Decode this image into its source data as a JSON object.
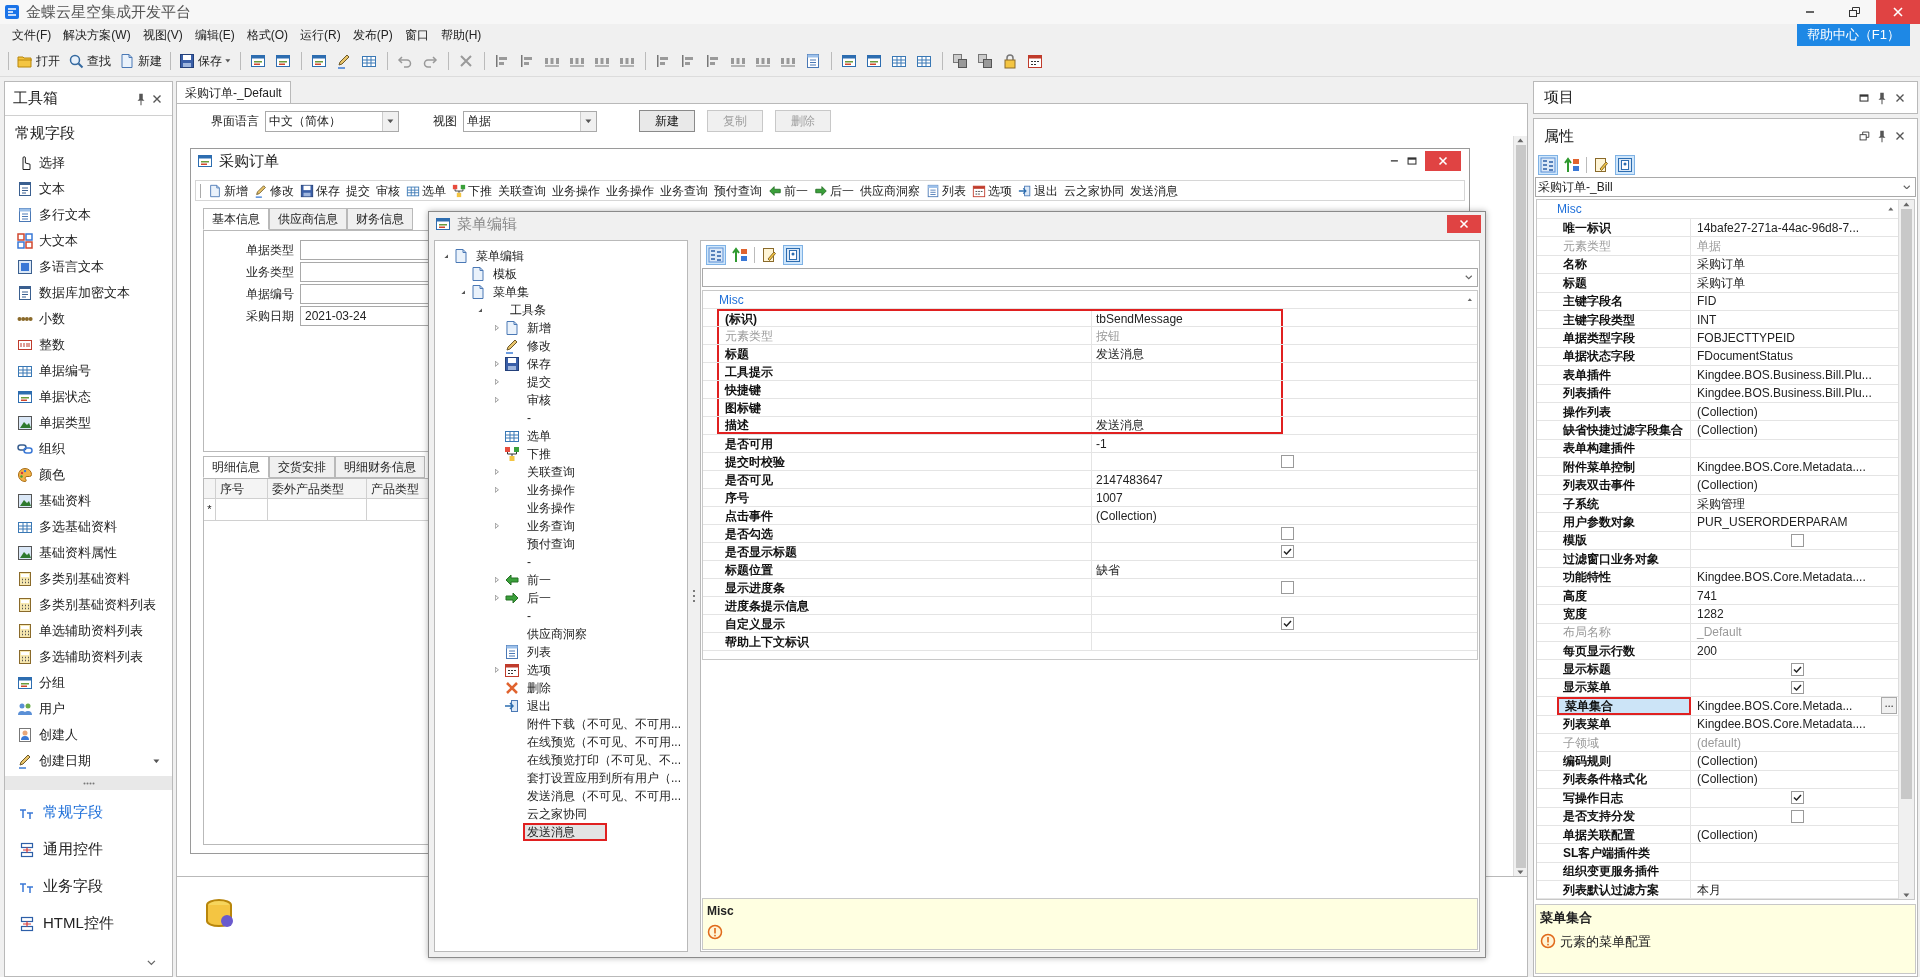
{
  "app": {
    "title": "金蝶云星空集成开发平台",
    "help_button": "帮助中心（F1）"
  },
  "menu": [
    "文件(F)",
    "解决方案(W)",
    "视图(V)",
    "编辑(E)",
    "格式(O)",
    "运行(R)",
    "发布(P)",
    "窗口",
    "帮助(H)"
  ],
  "toolbar": [
    {
      "label": "打开",
      "dropdown": false
    },
    {
      "label": "查找",
      "dropdown": false
    },
    {
      "label": "新建",
      "dropdown": false
    },
    {
      "label": "保存",
      "dropdown": true
    }
  ],
  "toolbox": {
    "title": "工具箱",
    "section": "常规字段",
    "items": [
      "选择",
      "文本",
      "多行文本",
      "大文本",
      "多语言文本",
      "数据库加密文本",
      "小数",
      "整数",
      "单据编号",
      "单据状态",
      "单据类型",
      "组织",
      "颜色",
      "基础资料",
      "多选基础资料",
      "基础资料属性",
      "多类别基础资料",
      "多类别基础资料列表",
      "单选辅助资料列表",
      "多选辅助资料列表",
      "分组",
      "用户",
      "创建人",
      "创建日期"
    ],
    "categories": [
      {
        "label": "常规字段",
        "selected": true
      },
      {
        "label": "通用控件",
        "selected": false
      },
      {
        "label": "业务字段",
        "selected": false
      },
      {
        "label": "HTML控件",
        "selected": false
      }
    ]
  },
  "document": {
    "tab": {
      "label": "采购订单-_Default",
      "selected": true
    },
    "language": {
      "label": "界面语言",
      "value": "中文（简体）"
    },
    "view": {
      "label": "视图",
      "value": "单据"
    },
    "buttons": [
      {
        "label": "新建",
        "disabled": false
      },
      {
        "label": "复制",
        "disabled": true
      },
      {
        "label": "删除",
        "disabled": true
      }
    ]
  },
  "form": {
    "title": "采购订单",
    "toolbar": [
      "新增",
      "修改",
      "保存",
      "提交",
      "审核",
      "选单",
      "下推",
      "关联查询",
      "业务操作",
      "业务操作",
      "业务查询",
      "预付查询",
      "前一",
      "后一",
      "供应商洞察",
      "列表",
      "选项",
      "退出",
      "云之家协同",
      "发送消息"
    ],
    "tabs": [
      {
        "label": "基本信息",
        "selected": true
      },
      {
        "label": "供应商信息",
        "selected": false
      },
      {
        "label": "财务信息",
        "selected": false
      }
    ],
    "fields": [
      {
        "label": "单据类型"
      },
      {
        "label": "业务类型"
      },
      {
        "label": "单据编号"
      },
      {
        "label": "采购日期",
        "value": "2021-03-24"
      }
    ],
    "detail_tabs": [
      {
        "label": "明细信息",
        "selected": true
      },
      {
        "label": "交货安排",
        "selected": false
      },
      {
        "label": "明细财务信息",
        "selected": false
      }
    ],
    "grid": {
      "columns": [
        "序号",
        "委外产品类型",
        "产品类型"
      ],
      "new_row_marker": "*"
    }
  },
  "menu_editor": {
    "title": "菜单编辑",
    "tree": [
      {
        "label": "菜单编辑",
        "expanded": true,
        "selected": false,
        "highlighted": false,
        "children": [
          {
            "label": "模板",
            "selected": false,
            "highlighted": false
          },
          {
            "label": "菜单集",
            "expanded": true,
            "selected": false,
            "highlighted": false,
            "children": [
              {
                "label": "工具条",
                "expanded": true,
                "selected": false,
                "highlighted": false,
                "children": [
                  {
                    "label": "新增",
                    "expanded": false,
                    "selected": false,
                    "highlighted": false
                  },
                  {
                    "label": "修改",
                    "selected": false,
                    "highlighted": false
                  },
                  {
                    "label": "保存",
                    "expanded": false,
                    "selected": false,
                    "highlighted": false
                  },
                  {
                    "label": "提交",
                    "expanded": false,
                    "selected": false,
                    "highlighted": false
                  },
                  {
                    "label": "审核",
                    "expanded": false,
                    "selected": false,
                    "highlighted": false
                  },
                  {
                    "label": "-",
                    "selected": false,
                    "highlighted": false
                  },
                  {
                    "label": "选单",
                    "selected": false,
                    "highlighted": false
                  },
                  {
                    "label": "下推",
                    "selected": false,
                    "highlighted": false
                  },
                  {
                    "label": "关联查询",
                    "expanded": false,
                    "selected": false,
                    "highlighted": false
                  },
                  {
                    "label": "业务操作",
                    "expanded": false,
                    "selected": false,
                    "highlighted": false
                  },
                  {
                    "label": "业务操作",
                    "selected": false,
                    "highlighted": false
                  },
                  {
                    "label": "业务查询",
                    "expanded": false,
                    "selected": false,
                    "highlighted": false
                  },
                  {
                    "label": "预付查询",
                    "selected": false,
                    "highlighted": false
                  },
                  {
                    "label": "-",
                    "selected": false,
                    "highlighted": false
                  },
                  {
                    "label": "前一",
                    "expanded": false,
                    "selected": false,
                    "highlighted": false
                  },
                  {
                    "label": "后一",
                    "expanded": false,
                    "selected": false,
                    "highlighted": false
                  },
                  {
                    "label": "-",
                    "selected": false,
                    "highlighted": false
                  },
                  {
                    "label": "供应商洞察",
                    "selected": false,
                    "highlighted": false
                  },
                  {
                    "label": "列表",
                    "selected": false,
                    "highlighted": false
                  },
                  {
                    "label": "选项",
                    "expanded": false,
                    "selected": false,
                    "highlighted": false
                  },
                  {
                    "label": "删除",
                    "selected": false,
                    "highlighted": false
                  },
                  {
                    "label": "退出",
                    "selected": false,
                    "highlighted": false
                  },
                  {
                    "label": "附件下载（不可见、不可用...",
                    "selected": false,
                    "highlighted": false
                  },
                  {
                    "label": "在线预览（不可见、不可用...",
                    "selected": false,
                    "highlighted": false
                  },
                  {
                    "label": "在线预览打印（不可见、不...",
                    "selected": false,
                    "highlighted": false
                  },
                  {
                    "label": "套打设置应用到所有用户（...",
                    "selected": false,
                    "highlighted": false
                  },
                  {
                    "label": "发送消息（不可见、不可用...",
                    "selected": false,
                    "highlighted": false
                  },
                  {
                    "label": "云之家协同",
                    "selected": false,
                    "highlighted": false
                  },
                  {
                    "label": "发送消息",
                    "selected": true,
                    "highlighted": true
                  }
                ]
              }
            ]
          }
        ]
      }
    ],
    "properties": {
      "category": "Misc",
      "rows": [
        {
          "name": "(标识)",
          "kind": "text",
          "value": "tbSendMessage",
          "disabled": false,
          "highlighted": true
        },
        {
          "name": "元素类型",
          "kind": "text",
          "value": "按钮",
          "disabled": true,
          "highlighted": true
        },
        {
          "name": "标题",
          "kind": "text",
          "value": "发送消息",
          "disabled": false,
          "highlighted": true
        },
        {
          "name": "工具提示",
          "kind": "text",
          "disabled": false,
          "highlighted": true
        },
        {
          "name": "快捷键",
          "kind": "text",
          "disabled": false,
          "highlighted": true
        },
        {
          "name": "图标键",
          "kind": "text",
          "disabled": false,
          "highlighted": true
        },
        {
          "name": "描述",
          "kind": "text",
          "value": "发送消息",
          "disabled": false,
          "highlighted": true
        },
        {
          "name": "是否可用",
          "kind": "text",
          "value": "-1",
          "disabled": false,
          "highlighted": false
        },
        {
          "name": "提交时校验",
          "kind": "checkbox",
          "checked": false,
          "disabled": false,
          "highlighted": false
        },
        {
          "name": "是否可见",
          "kind": "text",
          "value": "2147483647",
          "disabled": false,
          "highlighted": false
        },
        {
          "name": "序号",
          "kind": "text",
          "value": "1007",
          "disabled": false,
          "highlighted": false
        },
        {
          "name": "点击事件",
          "kind": "text",
          "value": "(Collection)",
          "disabled": false,
          "highlighted": false
        },
        {
          "name": "是否勾选",
          "kind": "checkbox",
          "checked": false,
          "disabled": false,
          "highlighted": false
        },
        {
          "name": "是否显示标题",
          "kind": "checkbox",
          "checked": true,
          "disabled": false,
          "highlighted": false
        },
        {
          "name": "标题位置",
          "kind": "text",
          "value": "缺省",
          "disabled": false,
          "highlighted": false
        },
        {
          "name": "显示进度条",
          "kind": "checkbox",
          "checked": false,
          "disabled": false,
          "highlighted": false
        },
        {
          "name": "进度条提示信息",
          "kind": "text",
          "disabled": false,
          "highlighted": false
        },
        {
          "name": "自定义显示",
          "kind": "checkbox",
          "checked": true,
          "disabled": false,
          "highlighted": false
        },
        {
          "name": "帮助上下文标识",
          "kind": "text",
          "disabled": false,
          "highlighted": false
        }
      ]
    },
    "description": {
      "title": "Misc"
    }
  },
  "project_panel": {
    "title": "项目"
  },
  "properties_panel": {
    "title": "属性",
    "object": "采购订单-_Bill",
    "category": "Misc",
    "rows": [
      {
        "name": "唯一标识",
        "kind": "text",
        "value": "14bafe27-271a-44ac-96d8-7...",
        "disabled": false,
        "selected": false,
        "highlighted": false
      },
      {
        "name": "元素类型",
        "kind": "text",
        "value": "单据",
        "disabled": true,
        "selected": false,
        "highlighted": false
      },
      {
        "name": "名称",
        "kind": "text",
        "value": "采购订单",
        "disabled": false,
        "selected": false,
        "highlighted": false
      },
      {
        "name": "标题",
        "kind": "text",
        "value": "采购订单",
        "disabled": false,
        "selected": false,
        "highlighted": false
      },
      {
        "name": "主键字段名",
        "kind": "text",
        "value": "FID",
        "disabled": false,
        "selected": false,
        "highlighted": false
      },
      {
        "name": "主键字段类型",
        "kind": "text",
        "value": "INT",
        "disabled": false,
        "selected": false,
        "highlighted": false
      },
      {
        "name": "单据类型字段",
        "kind": "text",
        "value": "FOBJECTTYPEID",
        "disabled": false,
        "selected": false,
        "highlighted": false
      },
      {
        "name": "单据状态字段",
        "kind": "text",
        "value": "FDocumentStatus",
        "disabled": false,
        "selected": false,
        "highlighted": false
      },
      {
        "name": "表单插件",
        "kind": "text",
        "value": "Kingdee.BOS.Business.Bill.Plu...",
        "disabled": false,
        "selected": false,
        "highlighted": false
      },
      {
        "name": "列表插件",
        "kind": "text",
        "value": "Kingdee.BOS.Business.Bill.Plu...",
        "disabled": false,
        "selected": false,
        "highlighted": false
      },
      {
        "name": "操作列表",
        "kind": "text",
        "value": "(Collection)",
        "disabled": false,
        "selected": false,
        "highlighted": false
      },
      {
        "name": "缺省快捷过滤字段集合",
        "kind": "text",
        "value": "(Collection)",
        "disabled": false,
        "selected": false,
        "highlighted": false
      },
      {
        "name": "表单构建插件",
        "kind": "text",
        "disabled": false,
        "selected": false,
        "highlighted": false
      },
      {
        "name": "附件菜单控制",
        "kind": "text",
        "value": "Kingdee.BOS.Core.Metadata....",
        "disabled": false,
        "selected": false,
        "highlighted": false
      },
      {
        "name": "列表双击事件",
        "kind": "text",
        "value": "(Collection)",
        "disabled": false,
        "selected": false,
        "highlighted": false
      },
      {
        "name": "子系统",
        "kind": "text",
        "value": "采购管理",
        "disabled": false,
        "selected": false,
        "highlighted": false
      },
      {
        "name": "用户参数对象",
        "kind": "text",
        "value": "PUR_USERORDERPARAM",
        "disabled": false,
        "selected": false,
        "highlighted": false
      },
      {
        "name": "模版",
        "kind": "checkbox",
        "checked": false,
        "disabled": false,
        "selected": false,
        "highlighted": false
      },
      {
        "name": "过滤窗口业务对象",
        "kind": "text",
        "disabled": false,
        "selected": false,
        "highlighted": false
      },
      {
        "name": "功能特性",
        "kind": "text",
        "value": "Kingdee.BOS.Core.Metadata....",
        "disabled": false,
        "selected": false,
        "highlighted": false
      },
      {
        "name": "高度",
        "kind": "text",
        "value": "741",
        "disabled": false,
        "selected": false,
        "highlighted": false
      },
      {
        "name": "宽度",
        "kind": "text",
        "value": "1282",
        "disabled": false,
        "selected": false,
        "highlighted": false
      },
      {
        "name": "布局名称",
        "kind": "text",
        "value": "_Default",
        "disabled": true,
        "selected": false,
        "highlighted": false
      },
      {
        "name": "每页显示行数",
        "kind": "text",
        "value": "200",
        "disabled": false,
        "selected": false,
        "highlighted": false
      },
      {
        "name": "显示标题",
        "kind": "checkbox",
        "checked": true,
        "disabled": false,
        "selected": false,
        "highlighted": false
      },
      {
        "name": "显示菜单",
        "kind": "checkbox",
        "checked": true,
        "disabled": false,
        "selected": false,
        "highlighted": false
      },
      {
        "name": "菜单集合",
        "kind": "text",
        "value": "Kingdee.BOS.Core.Metada...",
        "disabled": false,
        "selected": true,
        "highlighted": true
      },
      {
        "name": "列表菜单",
        "kind": "text",
        "value": "Kingdee.BOS.Core.Metadata....",
        "disabled": false,
        "selected": false,
        "highlighted": false
      },
      {
        "name": "子领域",
        "kind": "text",
        "value": "(default)",
        "disabled": true,
        "selected": false,
        "highlighted": false
      },
      {
        "name": "编码规则",
        "kind": "text",
        "value": "(Collection)",
        "disabled": false,
        "selected": false,
        "highlighted": false
      },
      {
        "name": "列表条件格式化",
        "kind": "text",
        "value": "(Collection)",
        "disabled": false,
        "selected": false,
        "highlighted": false
      },
      {
        "name": "写操作日志",
        "kind": "checkbox",
        "checked": true,
        "disabled": false,
        "selected": false,
        "highlighted": false
      },
      {
        "name": "是否支持分发",
        "kind": "checkbox",
        "checked": false,
        "disabled": false,
        "selected": false,
        "highlighted": false
      },
      {
        "name": "单据关联配置",
        "kind": "text",
        "value": "(Collection)",
        "disabled": false,
        "selected": false,
        "highlighted": false
      },
      {
        "name": "SL客户端插件类",
        "kind": "text",
        "disabled": false,
        "selected": false,
        "highlighted": false
      },
      {
        "name": "组织变更服务插件",
        "kind": "text",
        "disabled": false,
        "selected": false,
        "highlighted": false
      },
      {
        "name": "列表默认过滤方案",
        "kind": "text",
        "value": "本月",
        "disabled": false,
        "selected": false,
        "highlighted": false
      }
    ],
    "description": {
      "title": "菜单集合",
      "text": "元素的菜单配置"
    }
  }
}
